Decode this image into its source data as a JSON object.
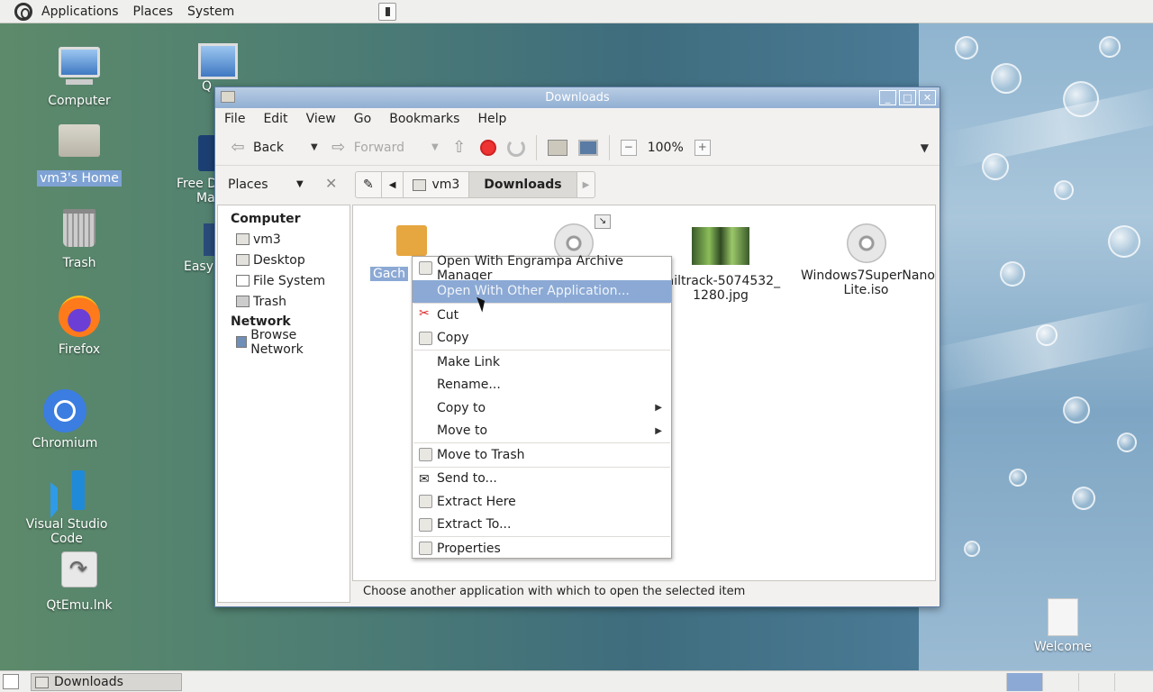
{
  "top_panel": {
    "applications": "Applications",
    "places": "Places",
    "system": "System"
  },
  "desktop": {
    "computer": "Computer",
    "home": "vm3's Home",
    "trash": "Trash",
    "firefox": "Firefox",
    "chromium": "Chromium",
    "vscode": "Visual Studio Code",
    "qtemu": "QtEmu.lnk",
    "partial1": "Q",
    "partial2a": "Free D",
    "partial2b": "Ma",
    "partial3": "Easy",
    "welcome": "Welcome"
  },
  "window": {
    "title": "Downloads",
    "menus": [
      "File",
      "Edit",
      "View",
      "Go",
      "Bookmarks",
      "Help"
    ],
    "back": "Back",
    "forward": "Forward",
    "zoom": "100%",
    "places_label": "Places",
    "crumbs": [
      "vm3",
      "Downloads"
    ],
    "sidebar": {
      "computer_head": "Computer",
      "items": [
        "vm3",
        "Desktop",
        "File System",
        "Trash"
      ],
      "network_head": "Network",
      "network_items": [
        "Browse Network"
      ]
    },
    "files": [
      {
        "name": "Gach"
      },
      {
        "name": ""
      },
      {
        "name": "railtrack-5074532_\n1280.jpg"
      },
      {
        "name": "Windows7SuperNano\nLite.iso"
      }
    ],
    "status": "Choose another application with which to open the selected item"
  },
  "context_menu": {
    "items": [
      "Open With Engrampa Archive Manager",
      "Open With Other Application...",
      "Cut",
      "Copy",
      "Make Link",
      "Rename...",
      "Copy to",
      "Move to",
      "Move to Trash",
      "Send to...",
      "Extract Here",
      "Extract To...",
      "Properties"
    ]
  },
  "taskbar": {
    "task": "Downloads"
  }
}
